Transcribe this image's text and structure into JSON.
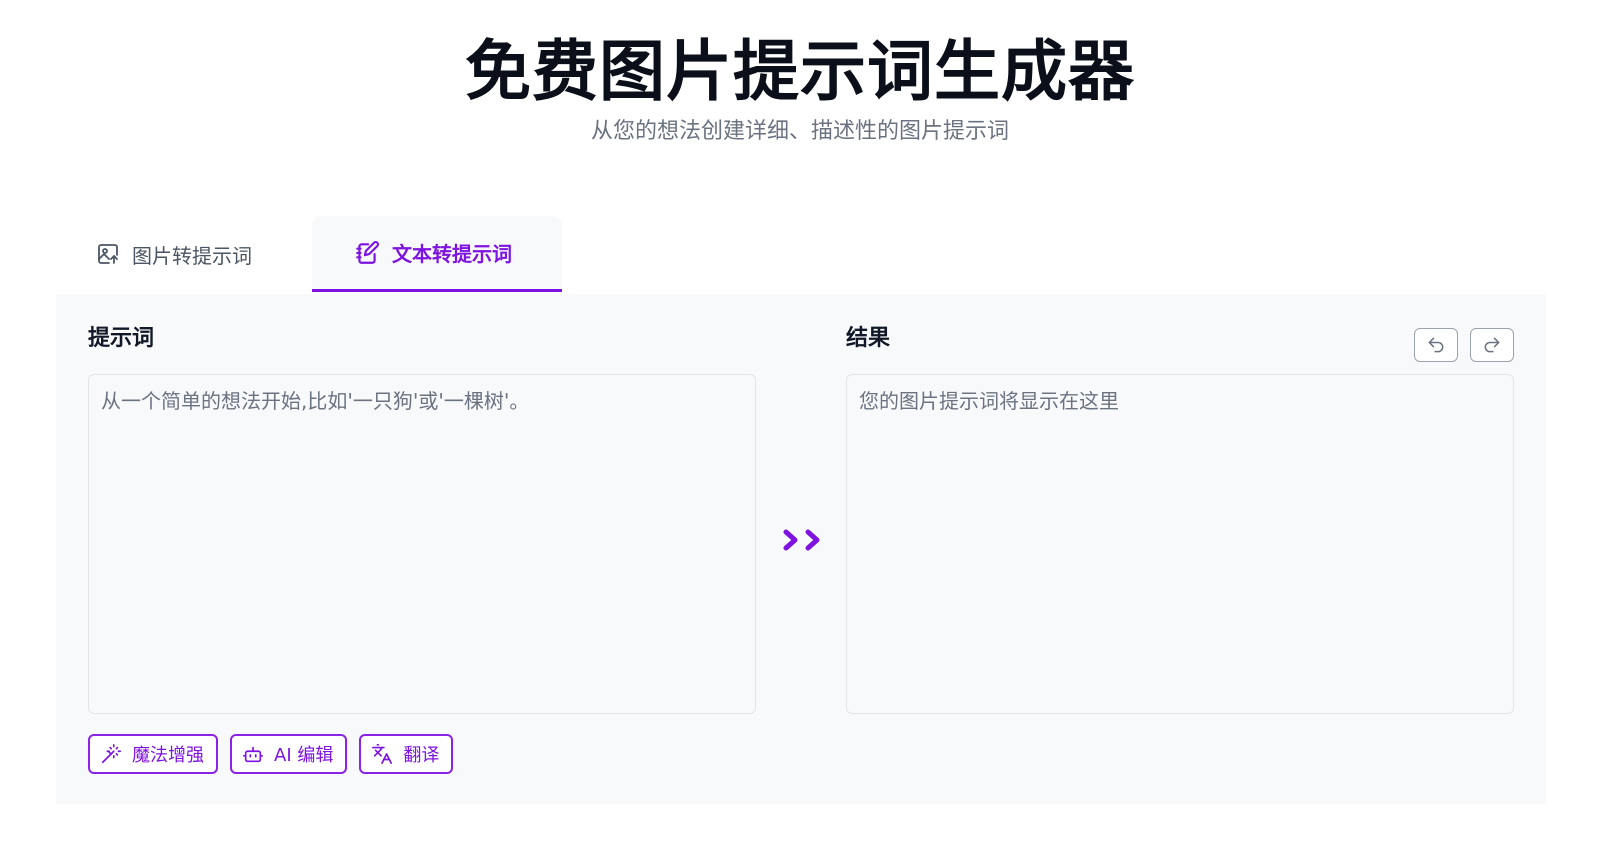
{
  "header": {
    "title": "免费图片提示词生成器",
    "subtitle": "从您的想法创建详细、描述性的图片提示词"
  },
  "tabs": [
    {
      "label": "图片转提示词",
      "icon": "image-upload-icon",
      "active": false
    },
    {
      "label": "文本转提示词",
      "icon": "notebook-edit-icon",
      "active": true
    }
  ],
  "prompt": {
    "label": "提示词",
    "placeholder": "从一个简单的想法开始,比如'一只狗'或'一棵树'。"
  },
  "result": {
    "label": "结果",
    "placeholder": "您的图片提示词将显示在这里"
  },
  "actions": [
    {
      "label": "魔法增强",
      "icon": "magic-wand-icon"
    },
    {
      "label": "AI 编辑",
      "icon": "robot-icon"
    },
    {
      "label": "翻译",
      "icon": "translate-icon"
    }
  ],
  "colors": {
    "accent": "#7e12e0",
    "panel_bg": "#f8f9fb",
    "muted_text": "#6b7280"
  }
}
